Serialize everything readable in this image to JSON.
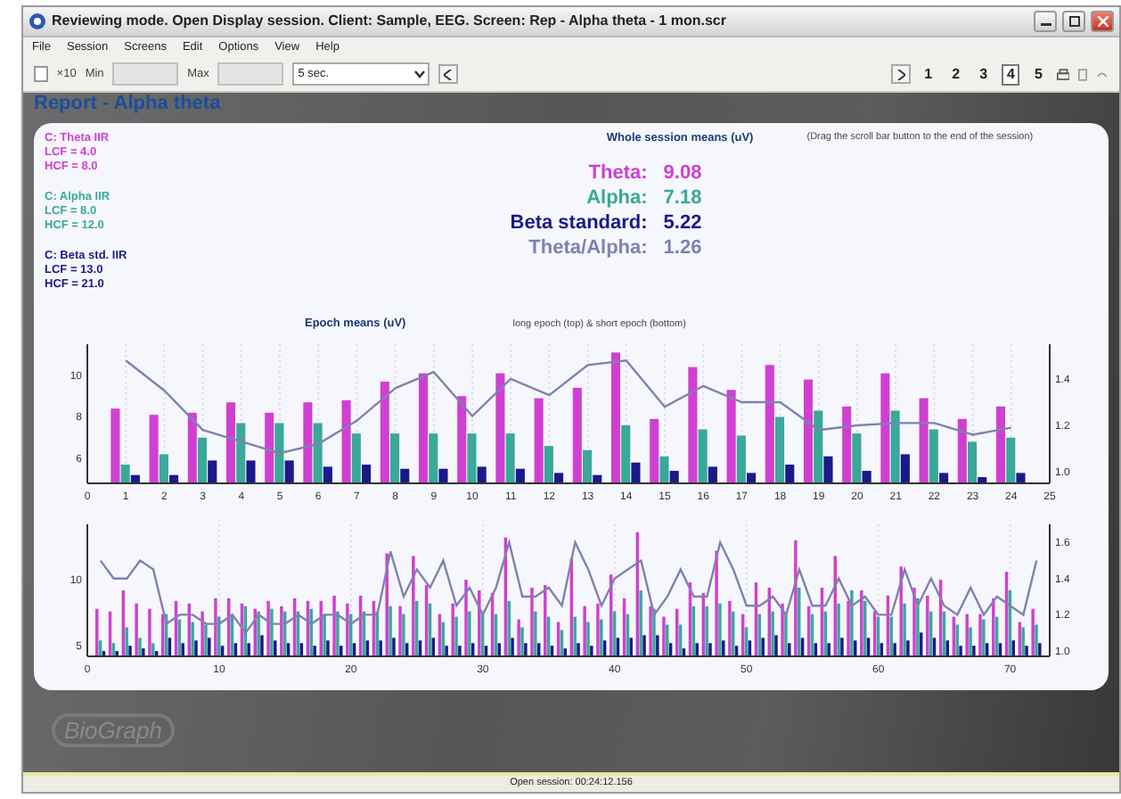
{
  "window": {
    "title": "Reviewing mode. Open Display session. Client: Sample, EEG. Screen: Rep - Alpha theta - 1 mon.scr"
  },
  "menu": [
    "File",
    "Session",
    "Screens",
    "Edit",
    "Options",
    "View",
    "Help"
  ],
  "toolbar": {
    "gain": {
      "label": "×10",
      "checked": false
    },
    "min": {
      "label": "Min"
    },
    "max": {
      "label": "Max"
    },
    "duration": {
      "value": "5 sec."
    },
    "pages": [
      {
        "label": "1",
        "selected": false
      },
      {
        "label": "2",
        "selected": false
      },
      {
        "label": "3",
        "selected": false
      },
      {
        "label": "4",
        "selected": true
      },
      {
        "label": "5",
        "selected": false
      }
    ]
  },
  "report": {
    "title": "Report - Alpha theta",
    "filters": [
      {
        "name": "C: Theta IIR",
        "lcf": "LCF = 4.0",
        "hcf": "HCF = 8.0",
        "color": "#d040d0"
      },
      {
        "name": "C: Alpha IIR",
        "lcf": "LCF = 8.0",
        "hcf": "HCF = 12.0",
        "color": "#3aa89a"
      },
      {
        "name": "C: Beta std. IIR",
        "lcf": "LCF = 13.0",
        "hcf": "HCF = 21.0",
        "color": "#1a1a8a"
      }
    ],
    "means_title": "Whole session means (uV)",
    "means_note": "(Drag the scroll bar button to the end of the session)",
    "means": [
      {
        "label": "Theta:",
        "value": "9.08",
        "color": "#d040d0"
      },
      {
        "label": "Alpha:",
        "value": "7.18",
        "color": "#3aa89a"
      },
      {
        "label": "Beta standard:",
        "value": "5.22",
        "color": "#1a1a8a"
      },
      {
        "label": "Theta/Alpha:",
        "value": "1.26",
        "color": "#8080b0"
      }
    ],
    "epoch_title": "Epoch means (uV)",
    "epoch_note": "long epoch (top) & short epoch (bottom)",
    "charts": [
      {
        "bars": {
          "chart_data": {
            "type": "bar",
            "grid": true,
            "x": [
              1,
              2,
              3,
              4,
              5,
              6,
              7,
              8,
              9,
              10,
              11,
              12,
              13,
              14,
              15,
              16,
              17,
              18,
              19,
              20,
              21,
              22,
              23,
              24
            ],
            "xlim": [
              0,
              25
            ],
            "ylim": [
              4.8,
              11.5
            ],
            "xticks": [
              0,
              1,
              2,
              3,
              4,
              5,
              6,
              7,
              8,
              9,
              10,
              11,
              12,
              13,
              14,
              15,
              16,
              17,
              18,
              19,
              20,
              21,
              22,
              23,
              24,
              25
            ],
            "yticks": [
              6,
              8,
              10
            ],
            "series": [
              {
                "color": "#d040d0",
                "values": [
                  8.4,
                  8.1,
                  8.2,
                  8.7,
                  8.2,
                  8.7,
                  8.8,
                  9.7,
                  10.1,
                  9.0,
                  10.1,
                  8.9,
                  9.4,
                  11.1,
                  7.9,
                  10.4,
                  9.3,
                  10.5,
                  9.8,
                  8.5,
                  10.1,
                  8.9,
                  7.9,
                  8.5
                ]
              },
              {
                "color": "#3aa89a",
                "values": [
                  5.7,
                  6.2,
                  7.0,
                  7.7,
                  7.7,
                  7.7,
                  7.2,
                  7.2,
                  7.2,
                  7.2,
                  7.2,
                  6.6,
                  6.4,
                  7.6,
                  6.1,
                  7.4,
                  7.1,
                  8.0,
                  8.3,
                  7.2,
                  8.3,
                  7.4,
                  6.8,
                  7.0
                ]
              },
              {
                "color": "#1a1a8a",
                "values": [
                  5.2,
                  5.2,
                  5.9,
                  5.9,
                  5.9,
                  5.6,
                  5.7,
                  5.5,
                  5.5,
                  5.6,
                  5.5,
                  5.3,
                  5.2,
                  5.8,
                  5.4,
                  5.6,
                  5.3,
                  5.7,
                  6.1,
                  5.4,
                  6.2,
                  5.3,
                  5.1,
                  5.3
                ]
              }
            ]
          }
        },
        "ratio": {
          "chart_data": {
            "type": "line",
            "x": [
              1,
              2,
              3,
              4,
              5,
              6,
              7,
              8,
              9,
              10,
              11,
              12,
              13,
              14,
              15,
              16,
              17,
              18,
              19,
              20,
              21,
              22,
              23,
              24
            ],
            "xlim": [
              0,
              25
            ],
            "ylim": [
              0.95,
              1.55
            ],
            "yticks": [
              {
                "value": 1.0,
                "label": "1.0"
              },
              {
                "value": 1.2,
                "label": "1.2"
              },
              {
                "value": 1.4,
                "label": "1.4"
              }
            ],
            "series": [
              {
                "color": "#8080b0",
                "values": [
                  1.48,
                  1.35,
                  1.18,
                  1.13,
                  1.08,
                  1.12,
                  1.22,
                  1.36,
                  1.43,
                  1.24,
                  1.4,
                  1.33,
                  1.46,
                  1.48,
                  1.28,
                  1.37,
                  1.3,
                  1.3,
                  1.18,
                  1.2,
                  1.21,
                  1.21,
                  1.16,
                  1.19
                ]
              }
            ]
          }
        }
      },
      {
        "bars": {
          "chart_data": {
            "type": "bar",
            "grid": true,
            "x": [
              1,
              2,
              3,
              4,
              5,
              6,
              7,
              8,
              9,
              10,
              11,
              12,
              13,
              14,
              15,
              16,
              17,
              18,
              19,
              20,
              21,
              22,
              23,
              24,
              25,
              26,
              27,
              28,
              29,
              30,
              31,
              32,
              33,
              34,
              35,
              36,
              37,
              38,
              39,
              40,
              41,
              42,
              43,
              44,
              45,
              46,
              47,
              48,
              49,
              50,
              51,
              52,
              53,
              54,
              55,
              56,
              57,
              58,
              59,
              60,
              61,
              62,
              63,
              64,
              65,
              66,
              67,
              68,
              69,
              70,
              71,
              72
            ],
            "xlim": [
              0,
              73
            ],
            "ylim": [
              4.2,
              14.2
            ],
            "xticks": [
              0,
              10,
              20,
              30,
              40,
              50,
              60,
              70
            ],
            "yticks": [
              5,
              10
            ],
            "series": [
              {
                "color": "#d040d0",
                "values": [
                  7.8,
                  7.6,
                  9.2,
                  8.2,
                  7.8,
                  7.4,
                  8.4,
                  8.2,
                  7.6,
                  8.6,
                  8.6,
                  8.2,
                  7.8,
                  8.4,
                  8.0,
                  8.6,
                  8.4,
                  8.4,
                  8.8,
                  8.2,
                  8.8,
                  8.4,
                  12.0,
                  8.0,
                  11.8,
                  9.6,
                  7.4,
                  8.2,
                  10.0,
                  9.2,
                  9.0,
                  13.2,
                  7.0,
                  9.4,
                  9.6,
                  6.8,
                  11.6,
                  8.0,
                  8.2,
                  10.4,
                  8.6,
                  13.6,
                  8.0,
                  7.2,
                  7.8,
                  9.8,
                  9.0,
                  12.2,
                  8.4,
                  7.4,
                  9.8,
                  9.4,
                  8.2,
                  13.0,
                  8.0,
                  9.4,
                  11.8,
                  8.4,
                  9.2,
                  7.6,
                  8.8,
                  11.0,
                  9.4,
                  8.8,
                  10.0,
                  7.2,
                  7.4,
                  7.4,
                  8.6,
                  10.6,
                  6.8,
                  7.8
                ]
              },
              {
                "color": "#3aa89a",
                "values": [
                  5.4,
                  5.2,
                  6.4,
                  5.6,
                  5.2,
                  7.4,
                  7.0,
                  6.8,
                  6.6,
                  7.2,
                  7.4,
                  8.0,
                  7.6,
                  7.8,
                  7.6,
                  7.6,
                  7.8,
                  7.4,
                  7.6,
                  7.4,
                  7.6,
                  7.6,
                  8.0,
                  7.4,
                  8.4,
                  8.2,
                  6.8,
                  7.2,
                  7.6,
                  7.4,
                  7.4,
                  8.4,
                  6.4,
                  7.6,
                  7.2,
                  6.2,
                  7.2,
                  6.8,
                  7.0,
                  7.6,
                  7.4,
                  9.2,
                  7.8,
                  6.6,
                  6.6,
                  8.0,
                  8.0,
                  8.2,
                  7.6,
                  6.4,
                  7.4,
                  7.6,
                  7.4,
                  9.4,
                  7.4,
                  7.6,
                  8.2,
                  9.2,
                  8.4,
                  7.2,
                  7.2,
                  8.2,
                  8.6,
                  7.6,
                  7.6,
                  6.6,
                  6.4,
                  7.0,
                  7.2,
                  9.2,
                  6.4,
                  6.6
                ]
              },
              {
                "color": "#1a1a8a",
                "values": [
                  4.6,
                  4.6,
                  5.0,
                  4.8,
                  4.6,
                  5.6,
                  5.2,
                  5.4,
                  5.6,
                  5.0,
                  5.2,
                  5.2,
                  5.8,
                  5.4,
                  5.2,
                  5.2,
                  5.0,
                  5.4,
                  5.0,
                  5.2,
                  5.4,
                  5.4,
                  5.6,
                  5.2,
                  5.4,
                  5.6,
                  5.0,
                  5.0,
                  5.2,
                  5.0,
                  5.2,
                  5.6,
                  5.2,
                  5.2,
                  5.0,
                  4.8,
                  5.2,
                  5.0,
                  5.4,
                  5.6,
                  5.6,
                  5.8,
                  5.8,
                  5.2,
                  4.8,
                  5.2,
                  5.2,
                  5.4,
                  5.0,
                  5.4,
                  5.6,
                  5.8,
                  5.2,
                  5.6,
                  5.2,
                  5.2,
                  5.6,
                  5.4,
                  5.6,
                  5.2,
                  5.2,
                  5.4,
                  6.0,
                  5.6,
                  5.4,
                  5.0,
                  5.0,
                  5.2,
                  5.2,
                  5.4,
                  5.0,
                  5.2
                ]
              }
            ]
          }
        },
        "ratio": {
          "chart_data": {
            "type": "line",
            "x": [
              1,
              2,
              3,
              4,
              5,
              6,
              7,
              8,
              9,
              10,
              11,
              12,
              13,
              14,
              15,
              16,
              17,
              18,
              19,
              20,
              21,
              22,
              23,
              24,
              25,
              26,
              27,
              28,
              29,
              30,
              31,
              32,
              33,
              34,
              35,
              36,
              37,
              38,
              39,
              40,
              41,
              42,
              43,
              44,
              45,
              46,
              47,
              48,
              49,
              50,
              51,
              52,
              53,
              54,
              55,
              56,
              57,
              58,
              59,
              60,
              61,
              62,
              63,
              64,
              65,
              66,
              67,
              68,
              69,
              70,
              71,
              72
            ],
            "xlim": [
              0,
              73
            ],
            "ylim": [
              0.97,
              1.7
            ],
            "yticks": [
              {
                "value": 1.0,
                "label": "1.0"
              },
              {
                "value": 1.2,
                "label": "1.2"
              },
              {
                "value": 1.4,
                "label": "1.4"
              },
              {
                "value": 1.6,
                "label": "1.6"
              }
            ],
            "series": [
              {
                "color": "#8080b0",
                "values": [
                  1.5,
                  1.4,
                  1.4,
                  1.5,
                  1.45,
                  1.15,
                  1.2,
                  1.2,
                  1.15,
                  1.15,
                  1.2,
                  1.1,
                  1.2,
                  1.15,
                  1.15,
                  1.2,
                  1.15,
                  1.2,
                  1.2,
                  1.15,
                  1.2,
                  1.2,
                  1.55,
                  1.3,
                  1.45,
                  1.35,
                  1.5,
                  1.25,
                  1.35,
                  1.2,
                  1.35,
                  1.6,
                  1.3,
                  1.3,
                  1.35,
                  1.25,
                  1.6,
                  1.45,
                  1.25,
                  1.4,
                  1.45,
                  1.5,
                  1.2,
                  1.3,
                  1.45,
                  1.3,
                  1.3,
                  1.6,
                  1.45,
                  1.25,
                  1.25,
                  1.3,
                  1.2,
                  1.45,
                  1.25,
                  1.25,
                  1.4,
                  1.25,
                  1.3,
                  1.2,
                  1.2,
                  1.45,
                  1.25,
                  1.4,
                  1.25,
                  1.2,
                  1.35,
                  1.2,
                  1.3,
                  1.25,
                  1.2,
                  1.5
                ]
              }
            ]
          }
        }
      }
    ]
  },
  "logo": "BioGraph",
  "status_bar": "Open session: 00:24:12.156"
}
